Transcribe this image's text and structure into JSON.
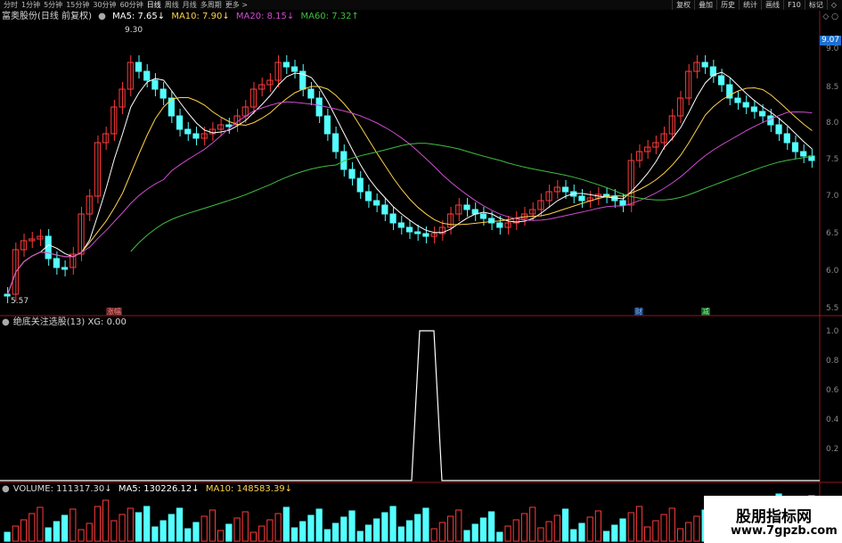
{
  "toolbar": {
    "tabs": [
      "分时",
      "1分钟",
      "5分钟",
      "15分钟",
      "30分钟",
      "60分钟",
      "日线",
      "周线",
      "月线",
      "多周期",
      "更多 >"
    ],
    "right_buttons": [
      "复权",
      "叠加",
      "历史",
      "统计",
      "画线",
      "F10",
      "标记",
      "◇"
    ]
  },
  "price_panel": {
    "title": "富奥股份(日线 前复权)",
    "ma5": "MA5: 7.65↓",
    "ma10": "MA10: 7.90↓",
    "ma20": "MA20: 8.15↓",
    "ma60": "MA60: 7.32↑",
    "high_label": "9.30",
    "low_label": "5.57",
    "current_price": "9.07",
    "y_ticks": [
      "9.0",
      "8.5",
      "8.0",
      "7.5",
      "7.0",
      "6.5",
      "6.0",
      "5.5"
    ],
    "markers": [
      "涨幅",
      "财",
      "减"
    ],
    "icons": [
      "diamond-icon",
      "settings-icon"
    ]
  },
  "indicator_panel": {
    "title": "绝底关注选股(13) XG: 0.00",
    "y_ticks": [
      "1.0",
      "0.8",
      "0.6",
      "0.4",
      "0.2"
    ]
  },
  "volume_panel": {
    "volume": "VOLUME: 111317.30↓",
    "ma5": "MA5: 130226.12↓",
    "ma10": "MA10: 148583.39↓"
  },
  "watermark": {
    "line1": "股朋指标网",
    "line2": "www.7gpzb.com"
  },
  "colors": {
    "up": "#ff3b3b",
    "down": "#54ffff",
    "ma5": "#ffffff",
    "ma10": "#ffd24a",
    "ma20": "#d04cd0",
    "ma60": "#3fbf3f",
    "price_tag": "#1e6fd0"
  }
}
